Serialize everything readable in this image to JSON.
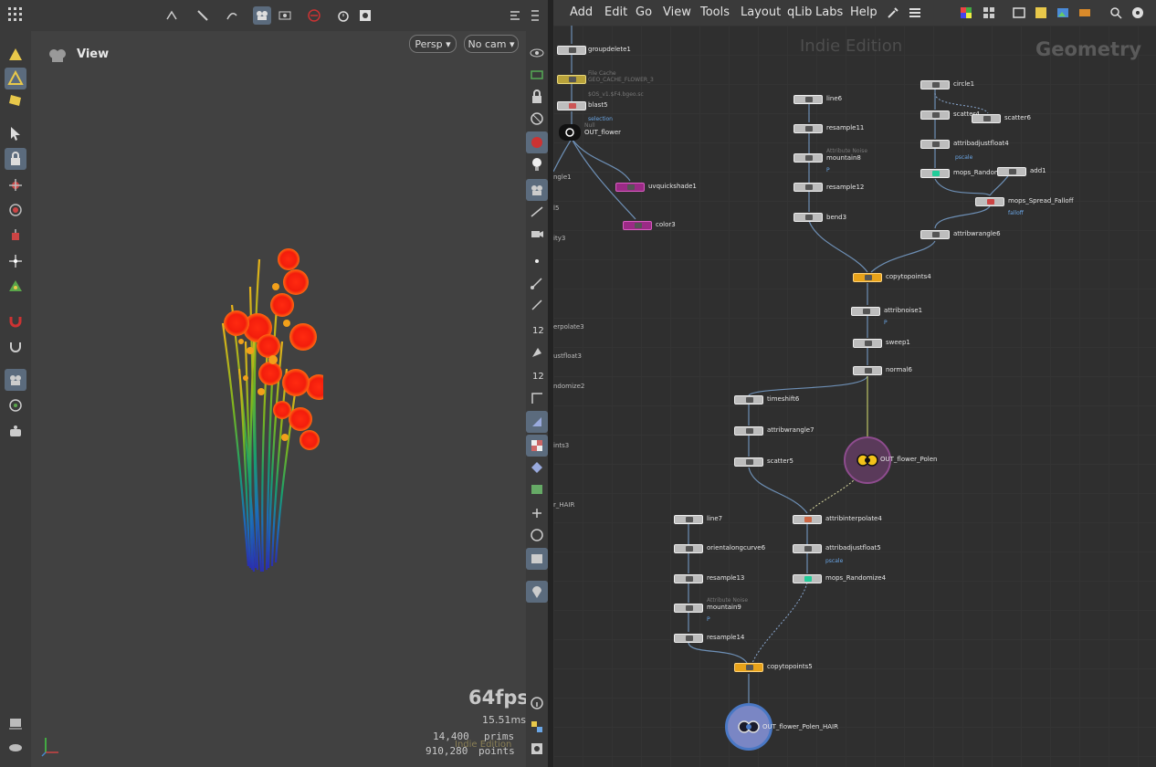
{
  "menubar": {
    "items": [
      "Add",
      "Edit",
      "Go",
      "View",
      "Tools",
      "Layout",
      "qLib",
      "Labs",
      "Help"
    ]
  },
  "viewport": {
    "title": "View",
    "camera_mode": "Persp ▾",
    "camera_select": "No cam ▾",
    "fps": "64fps",
    "frame_time": "15.51ms",
    "prims_count": "14,400",
    "prims_label": "prims",
    "points_count": "910,280",
    "points_label": "points",
    "watermark": "Indie Edition"
  },
  "network": {
    "edition": "Indie Edition",
    "context": "Geometry",
    "edge_labels": [
      "ngle1",
      "l5",
      "ity3",
      "erpolate3",
      "ustfloat3",
      "ndomize2",
      "ints3",
      "r_HAIR"
    ],
    "nodes": [
      {
        "name": "groupdelete1"
      },
      {
        "name": "GEO_CACHE_FLOWER_3",
        "sub": "File Cache",
        "sub2": "$OS_v1.$F4.bgeo.sc"
      },
      {
        "name": "blast5",
        "attr": "selection"
      },
      {
        "name": "OUT_flower",
        "sub": "Null"
      },
      {
        "name": "uvquickshade1"
      },
      {
        "name": "color3"
      },
      {
        "name": "line6"
      },
      {
        "name": "resample11"
      },
      {
        "name": "mountain8",
        "sub": "Attribute Noise",
        "attr": "P"
      },
      {
        "name": "resample12"
      },
      {
        "name": "bend3"
      },
      {
        "name": "circle1"
      },
      {
        "name": "scatter4"
      },
      {
        "name": "scatter6"
      },
      {
        "name": "attribadjustfloat4",
        "attr": "pscale"
      },
      {
        "name": "mops_Randomize2"
      },
      {
        "name": "add1"
      },
      {
        "name": "mops_Spread_Falloff",
        "attr": "falloff"
      },
      {
        "name": "attribwrangle6"
      },
      {
        "name": "copytopoints4"
      },
      {
        "name": "attribnoise1",
        "attr": "P"
      },
      {
        "name": "sweep1"
      },
      {
        "name": "normal6"
      },
      {
        "name": "timeshift6"
      },
      {
        "name": "attribwrangle7"
      },
      {
        "name": "scatter5"
      },
      {
        "name": "OUT_flower_Polen"
      },
      {
        "name": "line7"
      },
      {
        "name": "orientalongcurve6"
      },
      {
        "name": "resample13"
      },
      {
        "name": "mountain9",
        "sub": "Attribute Noise",
        "attr": "P"
      },
      {
        "name": "resample14"
      },
      {
        "name": "attribinterpolate4"
      },
      {
        "name": "attribadjustfloat5",
        "attr": "pscale"
      },
      {
        "name": "mops_Randomize4"
      },
      {
        "name": "copytopoints5"
      },
      {
        "name": "OUT_flower_Polen_HAIR"
      }
    ]
  },
  "colors": {
    "accent": "#5b6b7d",
    "copy_node": "#e7a21a",
    "shade_node": "#9b2a86",
    "attr_text": "#6aa6e6",
    "out_ring_polen": "#8e4c8e",
    "out_ring_hair": "#4a78c4"
  }
}
